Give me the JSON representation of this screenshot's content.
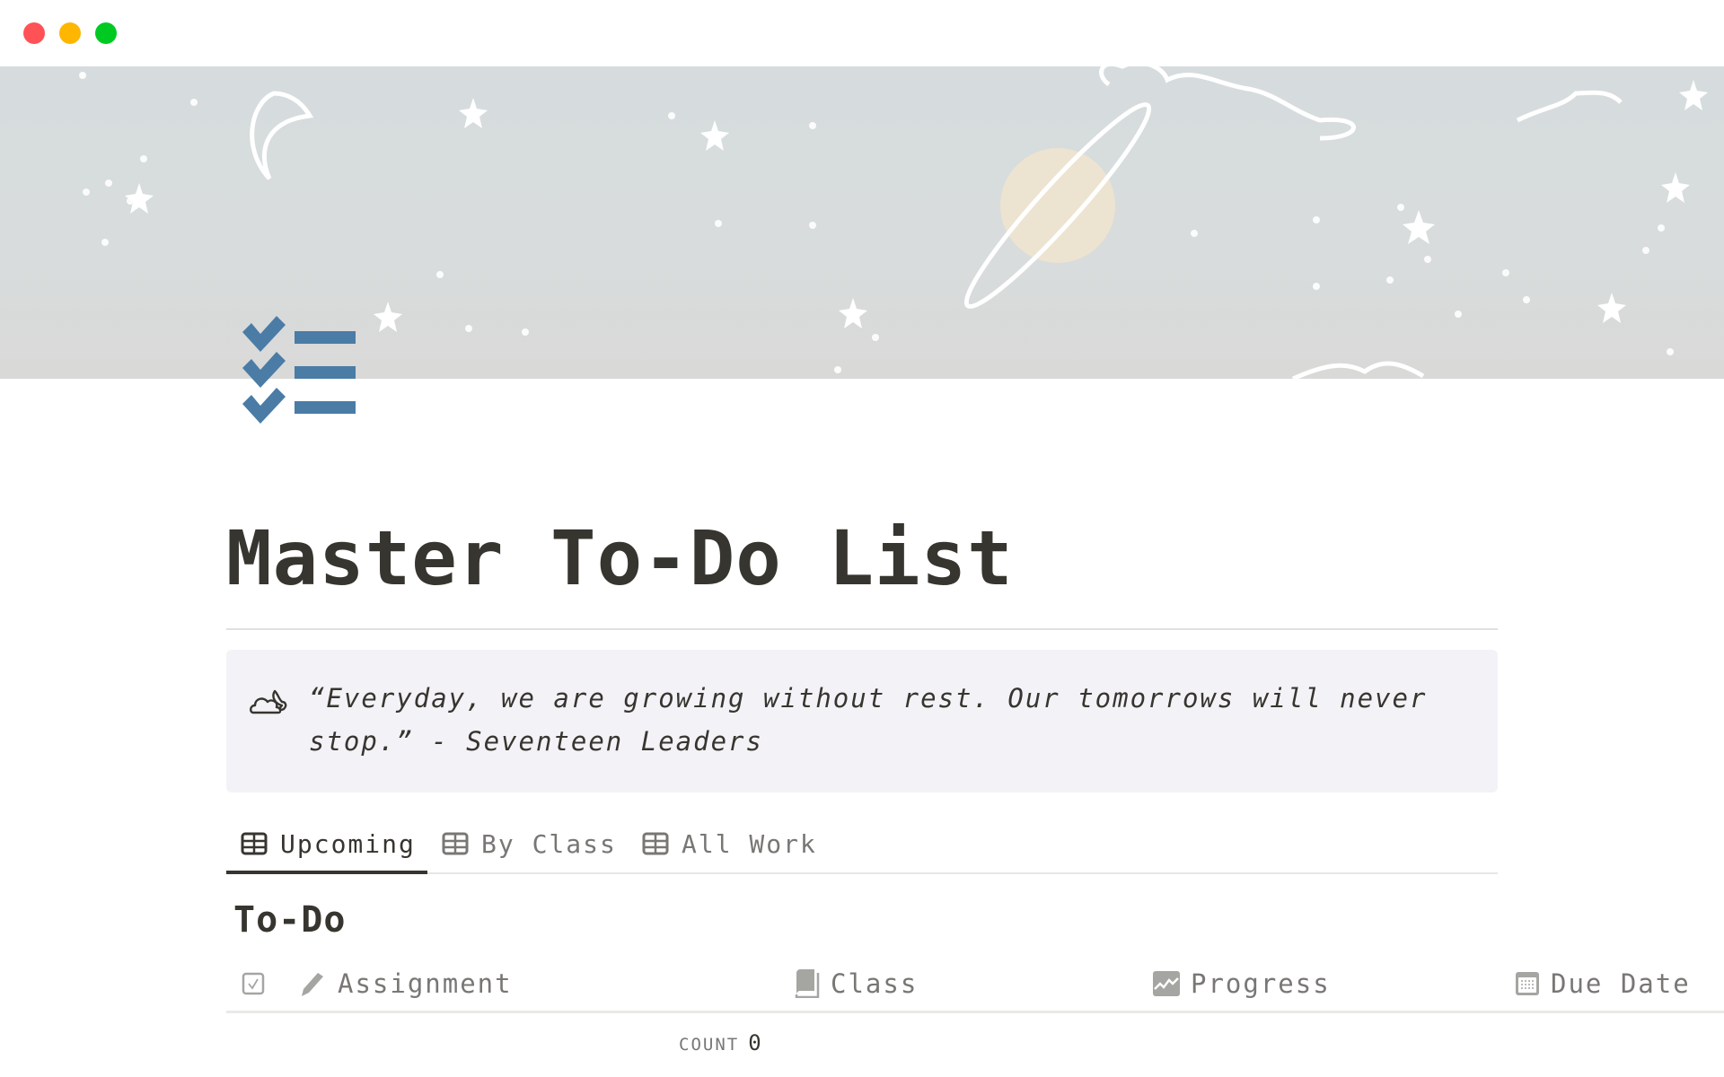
{
  "window": {
    "controls": [
      "close",
      "minimize",
      "maximize"
    ]
  },
  "page": {
    "icon": "checklist-icon",
    "title": "Master To-Do List"
  },
  "callout": {
    "icon": "cloud-moon-icon",
    "text": "“Everyday, we are growing without rest. Our tomorrows will never stop.” - Seventeen Leaders"
  },
  "tabs": [
    {
      "label": "Upcoming",
      "icon": "table-icon",
      "active": true
    },
    {
      "label": "By Class",
      "icon": "table-icon",
      "active": false
    },
    {
      "label": "All Work",
      "icon": "table-icon",
      "active": false
    }
  ],
  "section": {
    "title": "To-Do"
  },
  "table": {
    "columns": [
      {
        "label": "",
        "icon": "checkbox-icon"
      },
      {
        "label": "Assignment",
        "icon": "pencil-icon"
      },
      {
        "label": "Class",
        "icon": "book-icon"
      },
      {
        "label": "Progress",
        "icon": "chart-icon"
      },
      {
        "label": "Due Date",
        "icon": "calendar-icon"
      }
    ],
    "rows": [],
    "count_label": "COUNT",
    "count_value": "0"
  },
  "colors": {
    "accent_icon": "#4a7ca6",
    "text": "#37352f",
    "muted": "#787774",
    "callout_bg": "#f3f2f7"
  }
}
